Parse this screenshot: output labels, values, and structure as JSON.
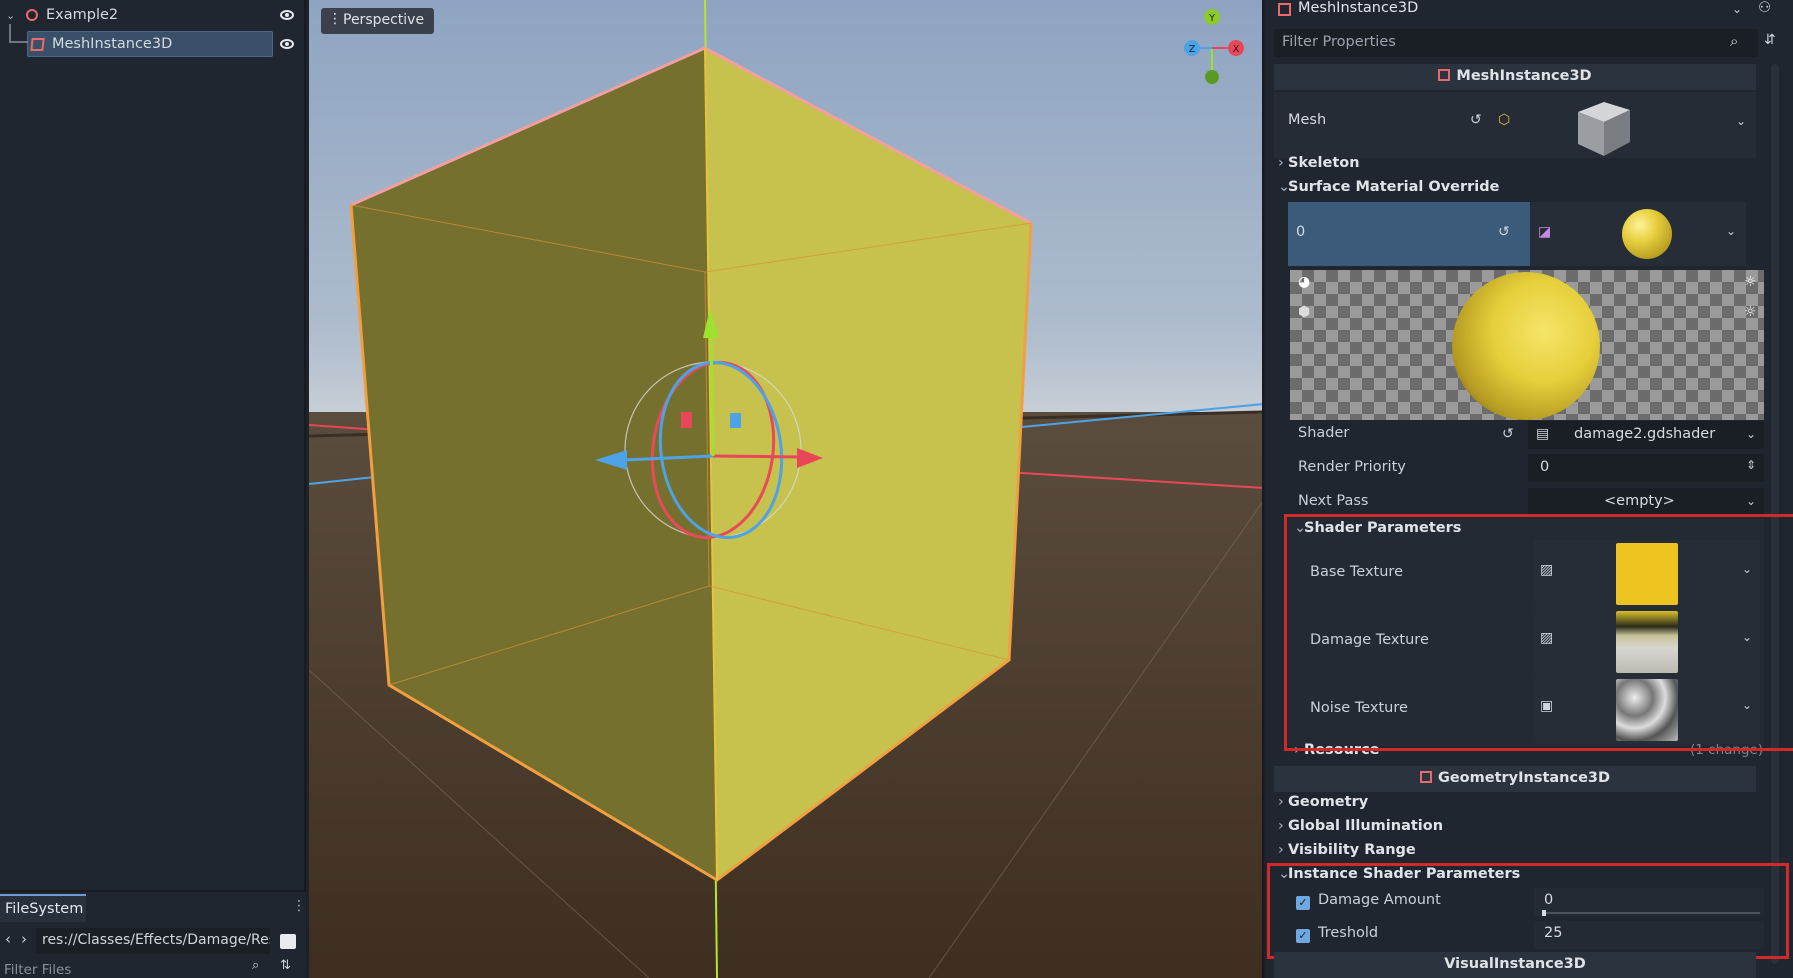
{
  "scene_tree": {
    "root_label": "Example2",
    "child_label": "MeshInstance3D"
  },
  "filesystem": {
    "tab_label": "FileSystem",
    "path": "res://Classes/Effects/Damage/Res",
    "filter_placeholder": "Filter Files"
  },
  "viewport": {
    "mode_label": "Perspective",
    "gizmo_x": "X",
    "gizmo_y": "Y",
    "gizmo_z": "Z"
  },
  "inspector": {
    "node_selector": "MeshInstance3D",
    "filter_placeholder": "Filter Properties",
    "mesh_section": "MeshInstance3D",
    "mesh_label": "Mesh",
    "skeleton_label": "Skeleton",
    "surface_override_label": "Surface Material Override",
    "surface_index": "0",
    "shader_label": "Shader",
    "shader_value": "damage2.gdshader",
    "render_priority_label": "Render Priority",
    "render_priority_value": "0",
    "next_pass_label": "Next Pass",
    "next_pass_value": "<empty>",
    "shader_params_label": "Shader Parameters",
    "base_texture_label": "Base Texture",
    "damage_texture_label": "Damage Texture",
    "noise_texture_label": "Noise Texture",
    "resource_label": "Resource",
    "resource_change": "(1 change)",
    "geometry_section": "GeometryInstance3D",
    "geometry_label": "Geometry",
    "gi_label": "Global Illumination",
    "visibility_range_label": "Visibility Range",
    "instance_params_label": "Instance Shader Parameters",
    "damage_amount_label": "Damage Amount",
    "damage_amount_value": "0",
    "treshold_label": "Treshold",
    "treshold_value": "25",
    "visual_section": "VisualInstance3D"
  },
  "colors": {
    "accent": "#6e9bd8",
    "highlight_box": "#d12a2a",
    "cube_yellow": "#c9c24a",
    "base_texture": "#eec520"
  }
}
